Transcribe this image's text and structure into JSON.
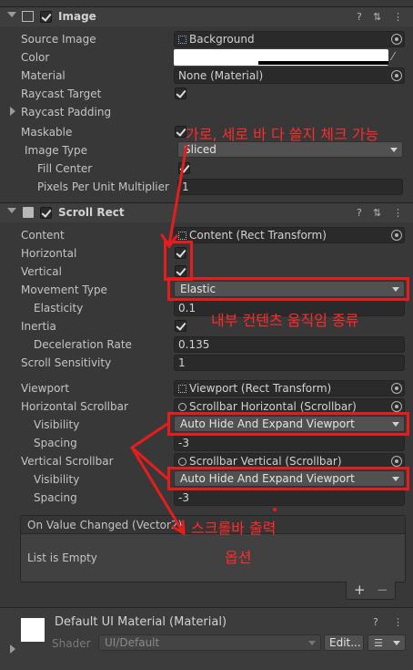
{
  "image_component": {
    "title": "Image",
    "fields": {
      "source_image_label": "Source Image",
      "source_image_value": "Background",
      "color_label": "Color",
      "material_label": "Material",
      "material_value": "None (Material)",
      "raycast_target_label": "Raycast Target",
      "raycast_padding_label": "Raycast Padding",
      "maskable_label": "Maskable",
      "image_type_label": "Image Type",
      "image_type_value": "Sliced",
      "fill_center_label": "Fill Center",
      "ppu_label": "Pixels Per Unit Multiplier",
      "ppu_value": "1"
    }
  },
  "scroll_rect": {
    "title": "Scroll Rect",
    "content_label": "Content",
    "content_value": "Content (Rect Transform)",
    "horizontal_label": "Horizontal",
    "vertical_label": "Vertical",
    "movement_type_label": "Movement Type",
    "movement_type_value": "Elastic",
    "elasticity_label": "Elasticity",
    "elasticity_value": "0.1",
    "inertia_label": "Inertia",
    "deceleration_label": "Deceleration Rate",
    "deceleration_value": "0.135",
    "sensitivity_label": "Scroll Sensitivity",
    "sensitivity_value": "1",
    "viewport_label": "Viewport",
    "viewport_value": "Viewport (Rect Transform)",
    "h_scrollbar_label": "Horizontal Scrollbar",
    "h_scrollbar_value": "Scrollbar Horizontal (Scrollbar)",
    "h_visibility_label": "Visibility",
    "h_visibility_value": "Auto Hide And Expand Viewport",
    "h_spacing_label": "Spacing",
    "h_spacing_value": "-3",
    "v_scrollbar_label": "Vertical Scrollbar",
    "v_scrollbar_value": "Scrollbar Vertical (Scrollbar)",
    "v_visibility_label": "Visibility",
    "v_visibility_value": "Auto Hide And Expand Viewport",
    "v_spacing_label": "Spacing",
    "v_spacing_value": "-3",
    "event_title": "On Value Changed (Vector2)",
    "event_empty": "List is Empty",
    "add_label": "+",
    "remove_label": "−"
  },
  "material_footer": {
    "title": "Default UI Material (Material)",
    "shader_label": "Shader",
    "shader_value": "UI/Default",
    "edit_label": "Edit..."
  },
  "annotations": {
    "checkbox_note": "가로, 세로 바 다 쓸지 체크 가능",
    "movement_note": "내부 컨텐츠 움직임 종류",
    "scrollbar_note_line1": "스크롤바 출력",
    "scrollbar_note_line2": "옵션"
  },
  "colors": {
    "annotation_red": "#e81c1c",
    "panel_bg": "#383838",
    "header_bg": "#3e3e3e"
  }
}
